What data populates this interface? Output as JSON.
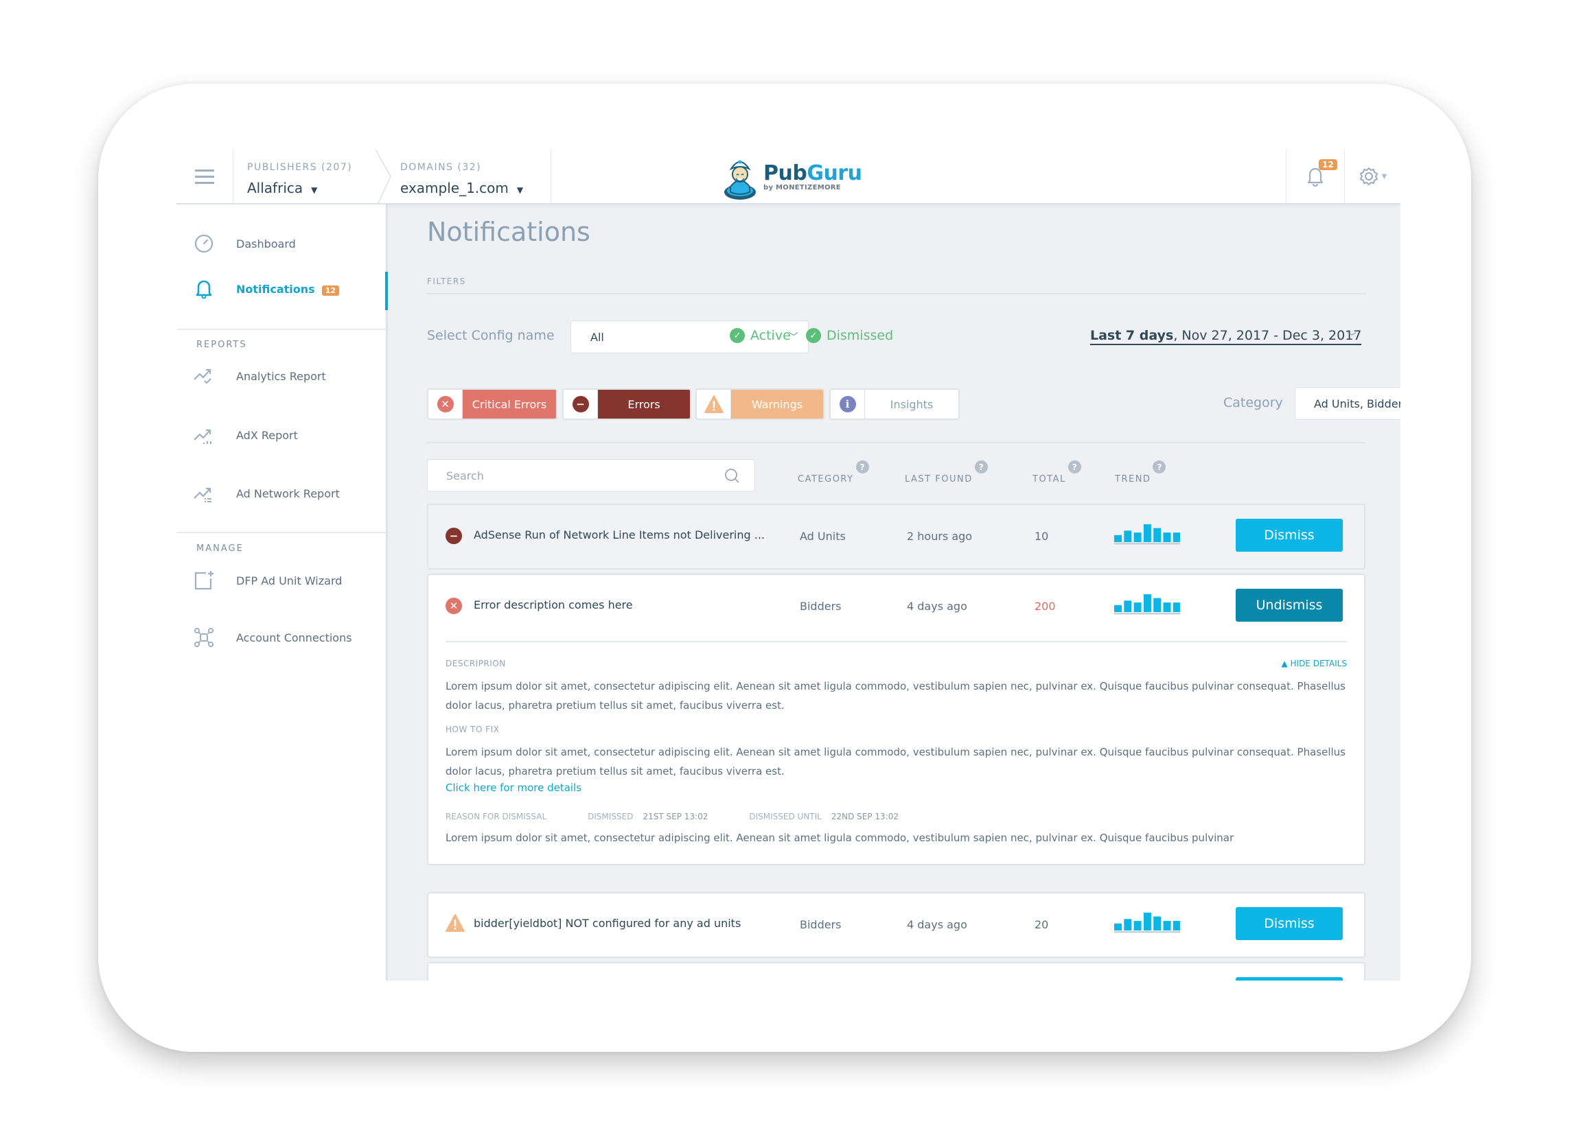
{
  "header": {
    "publishers": {
      "label": "PUBLISHERS (207)",
      "value": "Allafrica"
    },
    "domains": {
      "label": "DOMAINS (32)",
      "value": "example_1.com"
    },
    "logo": {
      "name": "PubGuru",
      "name_part1": "Pub",
      "name_part2": "Guru",
      "tagline": "by MONETIZEMORE"
    },
    "notifications_count": "12",
    "icons": {
      "menu": "hamburger-icon",
      "bell": "bell-icon",
      "settings": "gear-icon"
    }
  },
  "sidebar": {
    "items": [
      {
        "label": "Dashboard",
        "icon": "gauge-icon",
        "active": false
      },
      {
        "label": "Notifications",
        "icon": "bell-icon",
        "active": true,
        "badge": "12"
      }
    ],
    "sections": [
      {
        "title": "REPORTS",
        "items": [
          {
            "label": "Analytics Report",
            "icon": "trend-check-icon"
          },
          {
            "label": "AdX Report",
            "icon": "trend-bars-icon"
          },
          {
            "label": "Ad Network Report",
            "icon": "trend-list-icon"
          }
        ]
      },
      {
        "title": "MANAGE",
        "items": [
          {
            "label": "DFP Ad Unit Wizard",
            "icon": "add-square-icon"
          },
          {
            "label": "Account Connections",
            "icon": "network-icon"
          }
        ]
      }
    ]
  },
  "main": {
    "title": "Notifications",
    "filters_label": "FILTERS",
    "config": {
      "label": "Select Config name",
      "value": "All"
    },
    "status": [
      {
        "label": "Active",
        "checked": true
      },
      {
        "label": "Dismissed",
        "checked": true
      }
    ],
    "date_range": {
      "preset": "Last 7 days",
      "range": ", Nov 27, 2017 - Dec 3, 2017"
    },
    "severity": [
      {
        "label": "Critical Errors",
        "icon": "x-circle-icon",
        "color": "#df756b",
        "selected": true
      },
      {
        "label": "Errors",
        "icon": "minus-circle-icon",
        "color": "#85342e",
        "selected": true
      },
      {
        "label": "Warnings",
        "icon": "warning-triangle-icon",
        "color": "#f2b888",
        "selected": true
      },
      {
        "label": "Insights",
        "icon": "info-circle-icon",
        "color": "#7b84c3",
        "selected": false
      }
    ],
    "category": {
      "label": "Category",
      "value": "Ad Units,  Bidders,  DFP,  Others"
    },
    "search": {
      "placeholder": "Search",
      "value": ""
    },
    "columns": [
      "CATEGORY",
      "LAST FOUND",
      "TOTAL",
      "TREND"
    ],
    "rows": [
      {
        "severity": "error",
        "title": "AdSense Run of Network Line Items not Delivering ...",
        "category": "Ad Units",
        "last_found": "2 hours ago",
        "total": "10",
        "trend": [
          11,
          18,
          15,
          28,
          22,
          15,
          15
        ],
        "action": "Dismiss"
      },
      {
        "severity": "critical",
        "title": "Error description comes here",
        "category": "Bidders",
        "last_found": "4 days ago",
        "total": "200",
        "trend": [
          11,
          18,
          15,
          28,
          22,
          15,
          15
        ],
        "action": "Undismiss",
        "details": {
          "description_label": "DESCRIPRION",
          "hide_label": "HIDE DETAILS",
          "description": "Lorem ipsum dolor sit amet, consectetur adipiscing elit. Aenean sit amet ligula commodo, vestibulum sapien nec, pulvinar ex. Quisque faucibus pulvinar consequat. Phasellus dolor lacus, pharetra pretium tellus sit amet, faucibus viverra est.",
          "how_to_fix_label": "HOW TO FIX",
          "how_to_fix": "Lorem ipsum dolor sit amet, consectetur adipiscing elit. Aenean sit amet ligula commodo, vestibulum sapien nec, pulvinar ex. Quisque faucibus pulvinar consequat. Phasellus dolor lacus, pharetra pretium tellus sit amet, faucibus viverra est.",
          "link": "Click here for more details",
          "reason_label": "REASON FOR DISMISSAL",
          "dismissed_label": "DISMISSED",
          "dismissed_value": "21ST SEP 13:02",
          "dismissed_until_label": "DISMISSED  UNTIL",
          "dismissed_until_value": "22ND SEP 13:02",
          "reason": "Lorem ipsum dolor sit amet, consectetur adipiscing elit. Aenean sit amet ligula commodo, vestibulum sapien nec, pulvinar ex. Quisque faucibus pulvinar"
        }
      },
      {
        "severity": "warning",
        "title": "bidder[yieldbot] NOT configured for any ad units",
        "category": "Bidders",
        "last_found": "4 days ago",
        "total": "20",
        "trend": [
          11,
          18,
          15,
          28,
          22,
          15,
          15
        ],
        "action": "Dismiss"
      }
    ]
  }
}
